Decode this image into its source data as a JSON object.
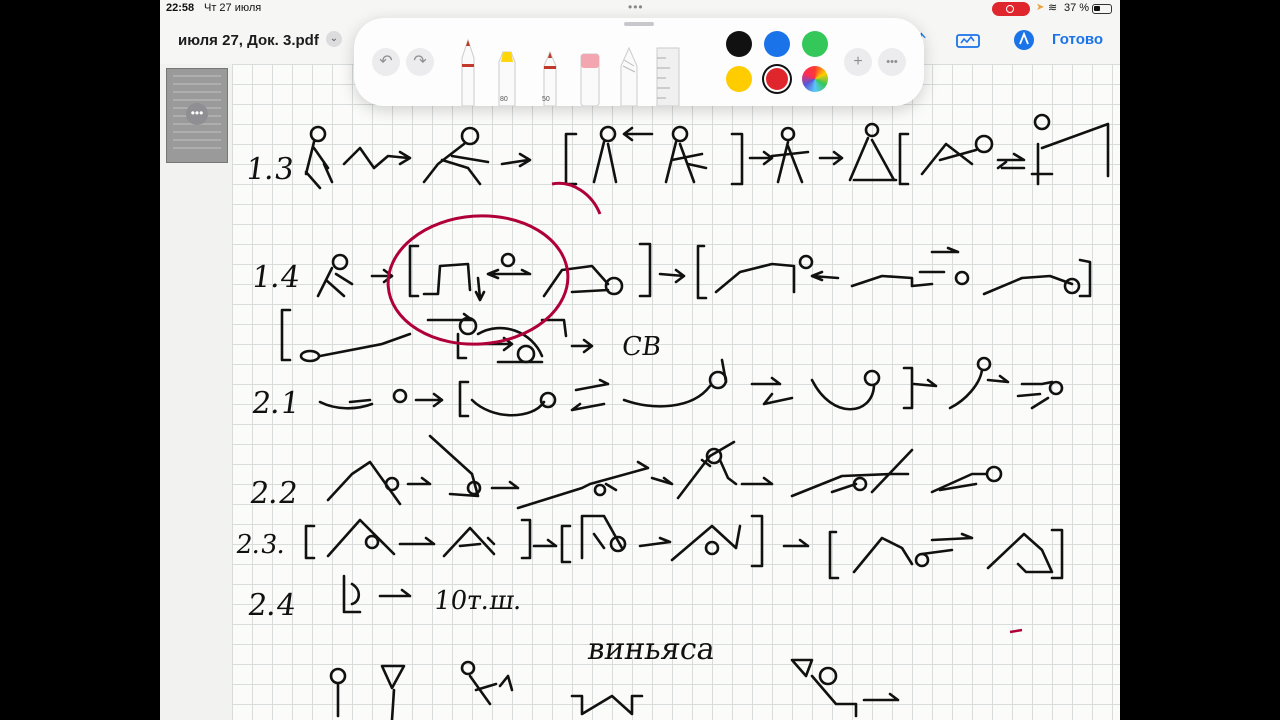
{
  "status_bar": {
    "time": "22:58",
    "date": "Чт 27 июля",
    "battery": "37 %"
  },
  "nav": {
    "doc_title": "июля 27, Док. 3.pdf",
    "done_label": "Готово"
  },
  "toolbar": {
    "pen_sizes": [
      "80",
      "50"
    ],
    "colors": [
      "#111111",
      "#1a73e8",
      "#34c759",
      "#ffcc00",
      "#e0262d"
    ],
    "selected_color": "#e0262d"
  },
  "page": {
    "rows": [
      "1.3",
      "1.4",
      "2.1",
      "2.2",
      "2.3.",
      "2.4"
    ],
    "row_2_4_text": "10т.ш.",
    "cb_text": "СВ",
    "heading": "виньяса"
  }
}
